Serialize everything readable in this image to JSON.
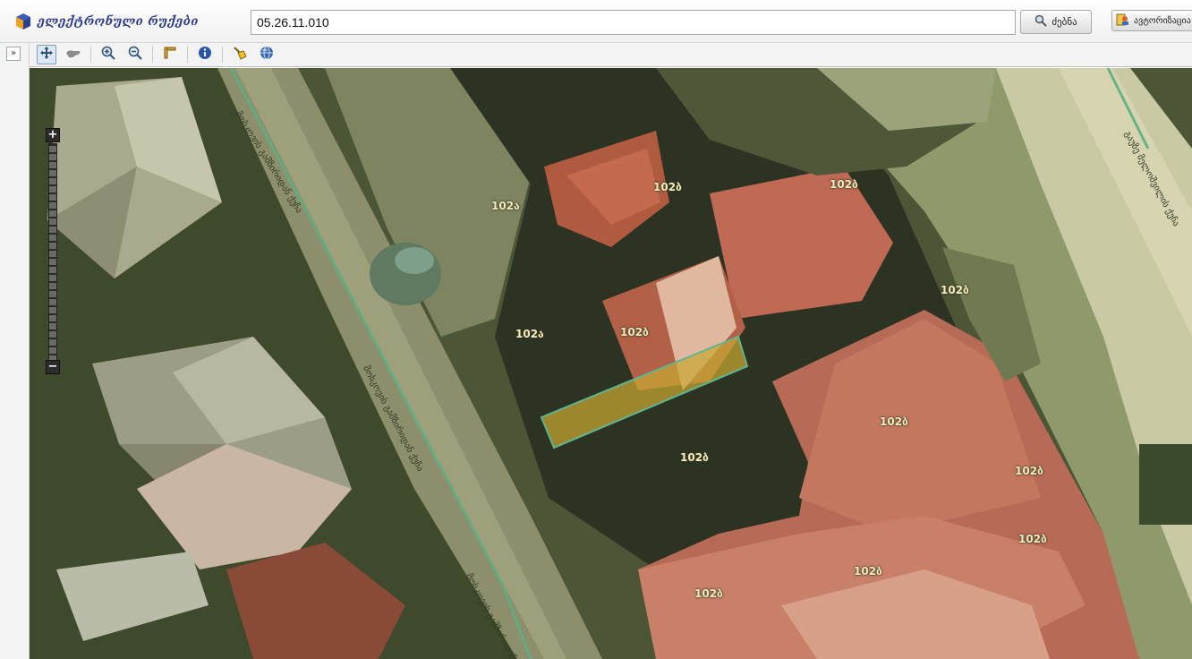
{
  "app": {
    "logo_text": "ელექტრონული რუქები"
  },
  "search": {
    "value": "05.26.11.010",
    "button_label": "ძებნა"
  },
  "auth": {
    "button_label": "ავტორიზაცია"
  },
  "left_panel": {
    "expand_label": "»"
  },
  "toolbar": {
    "tools": [
      {
        "name": "pan-tool",
        "icon": "pan-icon",
        "active": true
      },
      {
        "name": "zoom-box-tool",
        "icon": "hand-icon",
        "active": false
      },
      {
        "name": "zoom-in-tool",
        "icon": "zoom-in-icon",
        "active": false
      },
      {
        "name": "zoom-out-tool",
        "icon": "zoom-out-icon",
        "active": false
      },
      {
        "name": "measure-tool",
        "icon": "ruler-icon",
        "active": false
      },
      {
        "name": "info-tool",
        "icon": "info-icon",
        "active": false
      },
      {
        "name": "clear-tool",
        "icon": "broom-icon",
        "active": false
      },
      {
        "name": "globe-tool",
        "icon": "globe-icon",
        "active": false
      }
    ]
  },
  "map": {
    "zoom_in_label": "+",
    "zoom_out_label": "−",
    "parcel_labels": [
      "102ბ",
      "102ა",
      "102ბ",
      "102ბ",
      "102ბ",
      "102ა",
      "102ბ",
      "102ბ",
      "102ბ",
      "102ბ",
      "102ბ",
      "102ბ"
    ],
    "street_labels": [
      "მოსკოვის გამზირიდან ქუჩა",
      "მოსკოვის გამზირიდან ქუჩა",
      "მოსკოვის გამზირიდან ქუჩა",
      "გაუზე მელოშვილის ქუჩა"
    ],
    "colors": {
      "highlight_fill": "#c8a832",
      "highlight_stroke": "#5fb592",
      "street_line": "#5fae84"
    }
  }
}
